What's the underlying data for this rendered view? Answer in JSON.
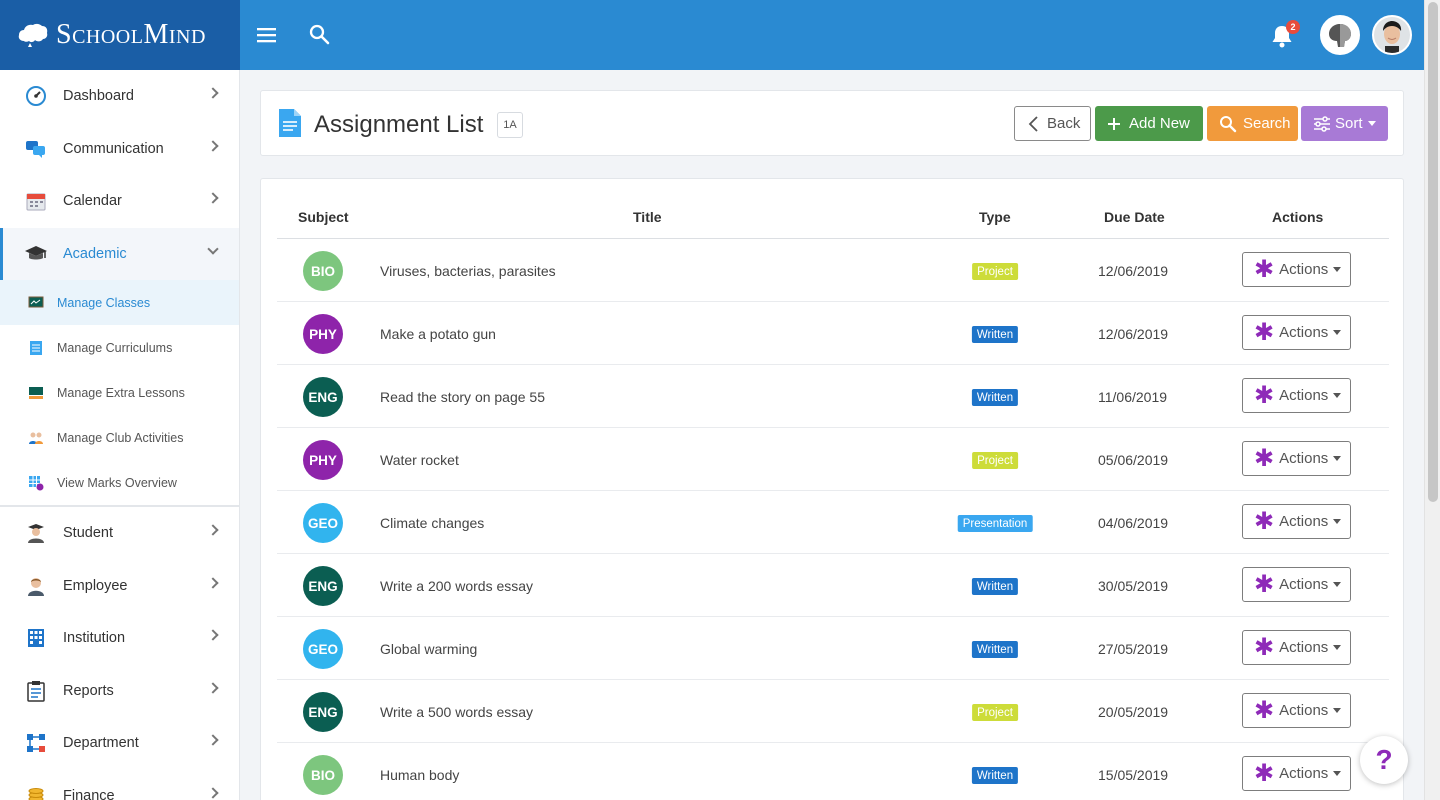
{
  "brand": {
    "name": "SchoolMind"
  },
  "notifications": {
    "count": "2"
  },
  "sidebar": {
    "items": [
      {
        "label": "Dashboard"
      },
      {
        "label": "Communication"
      },
      {
        "label": "Calendar"
      },
      {
        "label": "Academic"
      }
    ],
    "subitems": [
      {
        "label": "Manage Classes"
      },
      {
        "label": "Manage Curriculums"
      },
      {
        "label": "Manage Extra Lessons"
      },
      {
        "label": "Manage Club Activities"
      },
      {
        "label": "View Marks Overview"
      }
    ],
    "items2": [
      {
        "label": "Student"
      },
      {
        "label": "Employee"
      },
      {
        "label": "Institution"
      },
      {
        "label": "Reports"
      },
      {
        "label": "Department"
      },
      {
        "label": "Finance"
      }
    ]
  },
  "header": {
    "title": "Assignment List",
    "class_badge": "1A",
    "back_label": "Back",
    "add_label": "Add New",
    "search_label": "Search",
    "sort_label": "Sort"
  },
  "table": {
    "headers": {
      "subject": "Subject",
      "title": "Title",
      "type": "Type",
      "due": "Due Date",
      "actions": "Actions"
    },
    "action_label": "Actions",
    "rows": [
      {
        "subject": "BIO",
        "title": "Viruses, bacterias, parasites",
        "type": "Project",
        "due": "12/06/2019"
      },
      {
        "subject": "PHY",
        "title": "Make a potato gun",
        "type": "Written",
        "due": "12/06/2019"
      },
      {
        "subject": "ENG",
        "title": "Read the story on page 55",
        "type": "Written",
        "due": "11/06/2019"
      },
      {
        "subject": "PHY",
        "title": "Water rocket",
        "type": "Project",
        "due": "05/06/2019"
      },
      {
        "subject": "GEO",
        "title": "Climate changes",
        "type": "Presentation",
        "due": "04/06/2019"
      },
      {
        "subject": "ENG",
        "title": "Write a 200 words essay",
        "type": "Written",
        "due": "30/05/2019"
      },
      {
        "subject": "GEO",
        "title": "Global warming",
        "type": "Written",
        "due": "27/05/2019"
      },
      {
        "subject": "ENG",
        "title": "Write a 500 words essay",
        "type": "Project",
        "due": "20/05/2019"
      },
      {
        "subject": "BIO",
        "title": "Human body",
        "type": "Written",
        "due": "15/05/2019"
      }
    ]
  },
  "colors": {
    "BIO": "#7dc67e",
    "PHY": "#8e24aa",
    "ENG": "#0b5e52",
    "GEO": "#31b4ee",
    "Project": "#cddc39",
    "Written": "#1e74c9",
    "Presentation": "#3aa7f0"
  },
  "help": {
    "label": "?"
  }
}
